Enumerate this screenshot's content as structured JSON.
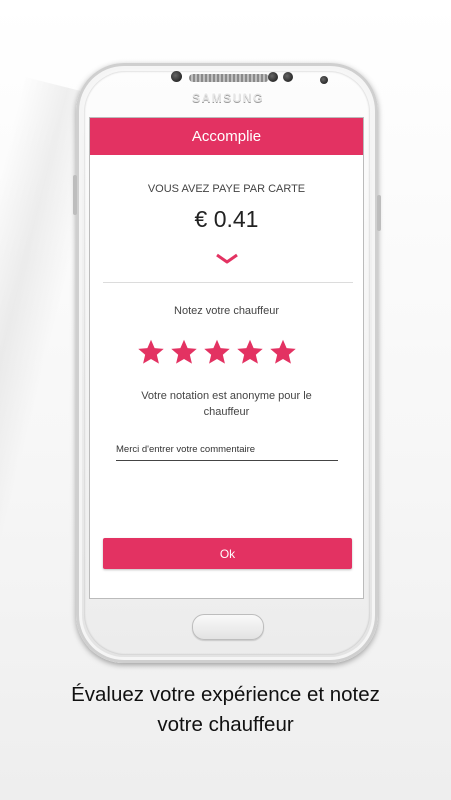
{
  "device": {
    "brand": "SAMSUNG"
  },
  "screen": {
    "header_title": "Accomplie",
    "payment_label": "VOUS AVEZ PAYE PAR CARTE",
    "amount": "€ 0.41",
    "rating_label": "Notez votre chauffeur",
    "rating": {
      "value": 5,
      "max": 5
    },
    "anonymous_note": "Votre notation est anonyme pour le chauffeur",
    "comment": {
      "placeholder": "Merci d'entrer votre commentaire",
      "value": ""
    },
    "ok_label": "Ok"
  },
  "caption": {
    "line1": "Évaluez votre expérience et notez",
    "line2": "votre chauffeur"
  },
  "colors": {
    "accent": "#e33262",
    "text": "#444444"
  },
  "icons": {
    "expand": "chevron-down-icon",
    "rating": "star-icon"
  }
}
